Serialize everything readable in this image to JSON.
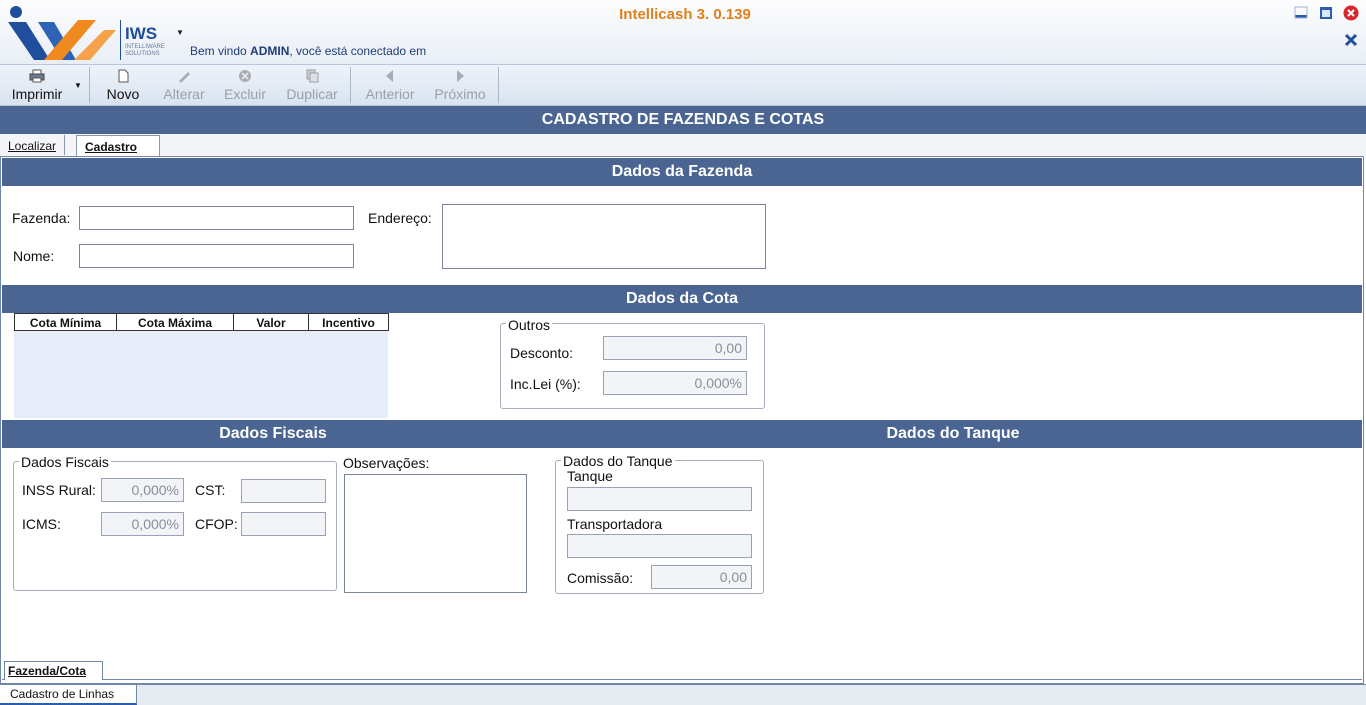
{
  "app": {
    "title": "Intellicash 3. 0.139",
    "logo_text": "IWS",
    "logo_sub": "INTELLIWARE SOLUTIONS",
    "welcome_prefix": "Bem vindo ",
    "welcome_user": "ADMIN",
    "welcome_suffix": ", você está conectado em"
  },
  "toolbar": {
    "print": "Imprimir",
    "new": "Novo",
    "edit": "Alterar",
    "delete": "Excluir",
    "duplicate": "Duplicar",
    "previous": "Anterior",
    "next": "Próximo"
  },
  "page_title": "CADASTRO DE FAZENDAS E COTAS",
  "tabs": {
    "find": "Localizar",
    "register": "Cadastro"
  },
  "fazenda": {
    "section": "Dados da Fazenda",
    "fazenda_label": "Fazenda:",
    "nome_label": "Nome:",
    "endereco_label": "Endereço:",
    "fazenda_value": "",
    "nome_value": "",
    "endereco_value": ""
  },
  "cota": {
    "section": "Dados da Cota",
    "columns": [
      "Cota Mínima",
      "Cota Máxima",
      "Valor",
      "Incentivo"
    ],
    "outros_legend": "Outros",
    "desconto_label": "Desconto:",
    "desconto_value": "0,00",
    "inclei_label": "Inc.Lei (%):",
    "inclei_value": "0,000%"
  },
  "fiscais": {
    "section": "Dados Fiscais",
    "legend": "Dados Fiscais",
    "inss_label": "INSS Rural:",
    "inss_value": "0,000%",
    "cst_label": "CST:",
    "cst_value": "",
    "icms_label": "ICMS:",
    "icms_value": "0,000%",
    "cfop_label": "CFOP:",
    "cfop_value": "",
    "obs_label": "Observações:",
    "obs_value": ""
  },
  "tanque": {
    "section": "Dados do Tanque",
    "legend": "Dados do Tanque",
    "tanque_label": "Tanque",
    "tanque_value": "",
    "transportadora_label": "Transportadora",
    "transportadora_value": "",
    "comissao_label": "Comissão:",
    "comissao_value": "0,00"
  },
  "bottom_tabs": {
    "inner": "Fazenda/Cota",
    "outer": "Cadastro de Linhas"
  },
  "colors": {
    "bar": "#4a6592",
    "title": "#e0801a",
    "logo_blue": "#1f4e9c",
    "logo_orange": "#f08a1e",
    "close": "#d8262a"
  }
}
